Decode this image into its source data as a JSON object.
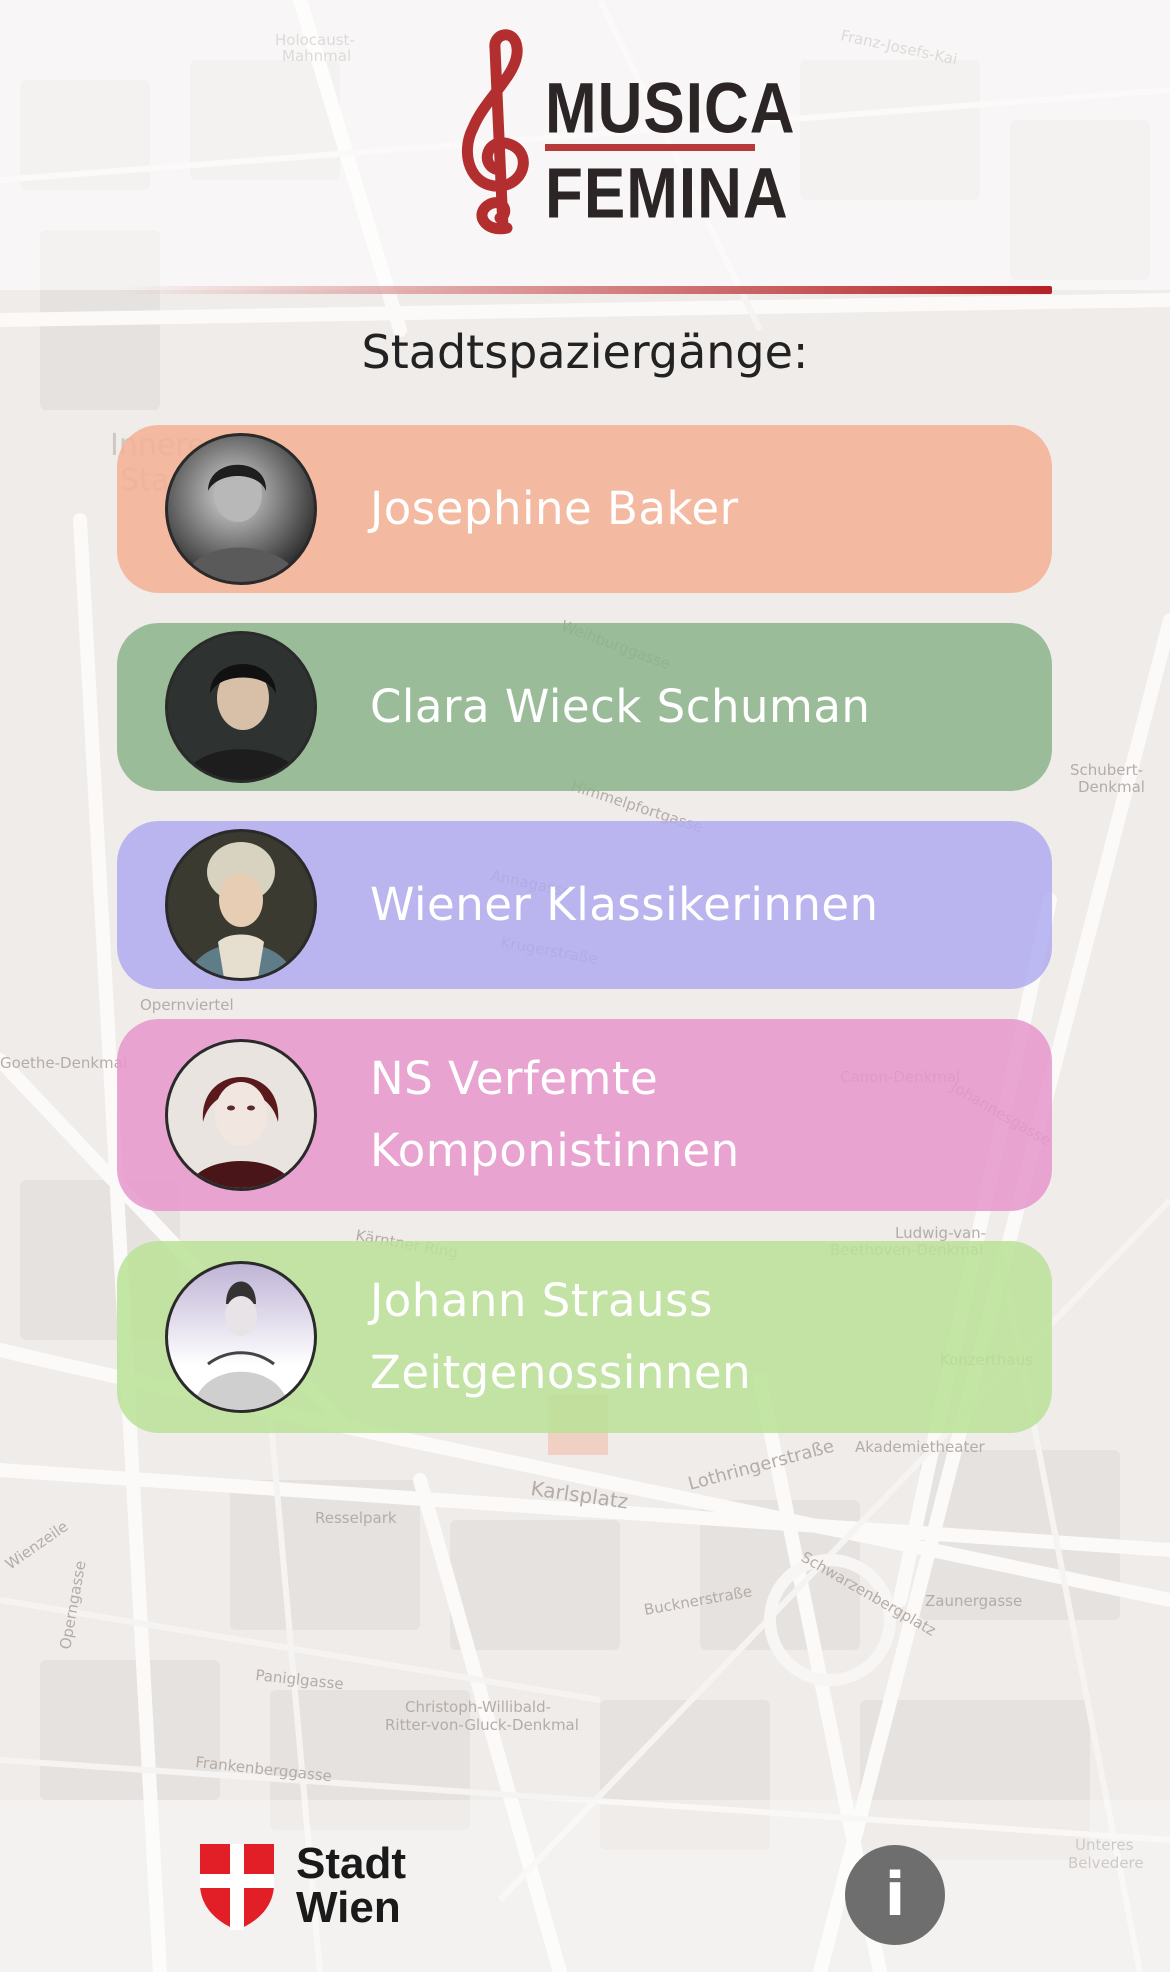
{
  "app": {
    "logo_line1": "MUSICA",
    "logo_line2": "FEMINA"
  },
  "header": {
    "subtitle": "Stadtspaziergänge:"
  },
  "walks": [
    {
      "label": "Josephine Baker",
      "color": "#f5b79c",
      "avatar_icon": "portrait-josephine-baker"
    },
    {
      "label": "Clara Wieck Schuman",
      "color": "#94b893",
      "avatar_icon": "portrait-clara-wieck-schumann"
    },
    {
      "label": "Wiener Klassikerinnen",
      "color": "#b5b2ee",
      "avatar_icon": "portrait-classical-woman"
    },
    {
      "label_lines": [
        "NS Verfemte",
        "Komponistinnen"
      ],
      "color": "#e59ccc",
      "avatar_icon": "portrait-ns-composer"
    },
    {
      "label_lines": [
        "Johann Strauss",
        "Zeitgenossinnen"
      ],
      "color": "#bde39c",
      "avatar_icon": "portrait-strauss-era-woman"
    }
  ],
  "footer": {
    "sponsor_line1": "Stadt",
    "sponsor_line2": "Wien",
    "info_label": "i"
  },
  "map_labels": [
    "Franz-Josefs-Kai",
    "Holocaust-Mahnmal",
    "Innere Stadt",
    "Schubert-Denkmal",
    "Karlsplatz",
    "Lothringerstraße",
    "Akademietheater",
    "Zaunergasse",
    "Resselpark",
    "Christoph-Willibald-Ritter-von-Gluck-Denkmal",
    "Frankenberggasse",
    "Schwarzenbergplatz",
    "Bucknerstraße",
    "Paniglgasse",
    "Operngasse",
    "Wienzeile",
    "Unteres Belvedere",
    "Goethe-Denkmal",
    "Opernviertel",
    "Krugerstraße",
    "Annagasse",
    "Himmelpfortgasse",
    "Weihburggasse",
    "Kärntner Ring",
    "Ludwig-van-Beethoven-Denkmal",
    "Konzerthaus",
    "Johannesgasse",
    "Canon-Denkmal"
  ]
}
